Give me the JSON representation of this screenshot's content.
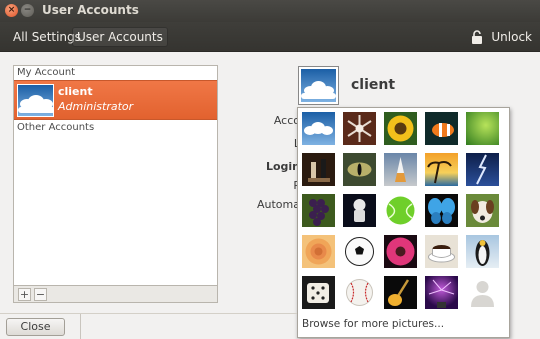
{
  "window": {
    "title": "User Accounts"
  },
  "toolbar": {
    "all_settings": "All Settings",
    "user_accounts": "User Accounts",
    "unlock": "Unlock"
  },
  "account_list": {
    "my_account_header": "My Account",
    "selected_user": {
      "name": "client",
      "role": "Administrator"
    },
    "other_accounts_header": "Other Accounts",
    "add_label": "+",
    "remove_label": "−"
  },
  "details": {
    "username": "client",
    "labels": {
      "account_type": "Acco",
      "language": "L",
      "login_options": "Login",
      "password": "P",
      "automatic_login": "Automa"
    }
  },
  "picture_popup": {
    "pictures": [
      "cloud",
      "snowflake",
      "sunflower",
      "clownfish",
      "leaf",
      "chess-king",
      "eye",
      "space-shuttle",
      "sunset-palm",
      "lightning",
      "grapes",
      "astronaut",
      "tennis-ball",
      "butterfly",
      "dog",
      "rose",
      "soccer-ball",
      "gerbera",
      "coffee-cup",
      "penguin",
      "dice",
      "baseball",
      "guitar",
      "plasma-ball",
      "generic-person"
    ],
    "browse_label": "Browse for more pictures..."
  },
  "footer": {
    "close_label": "Close"
  },
  "colors": {
    "accent": "#e86a36",
    "titlebar": "#3c3b37",
    "background": "#f2f1f0"
  }
}
